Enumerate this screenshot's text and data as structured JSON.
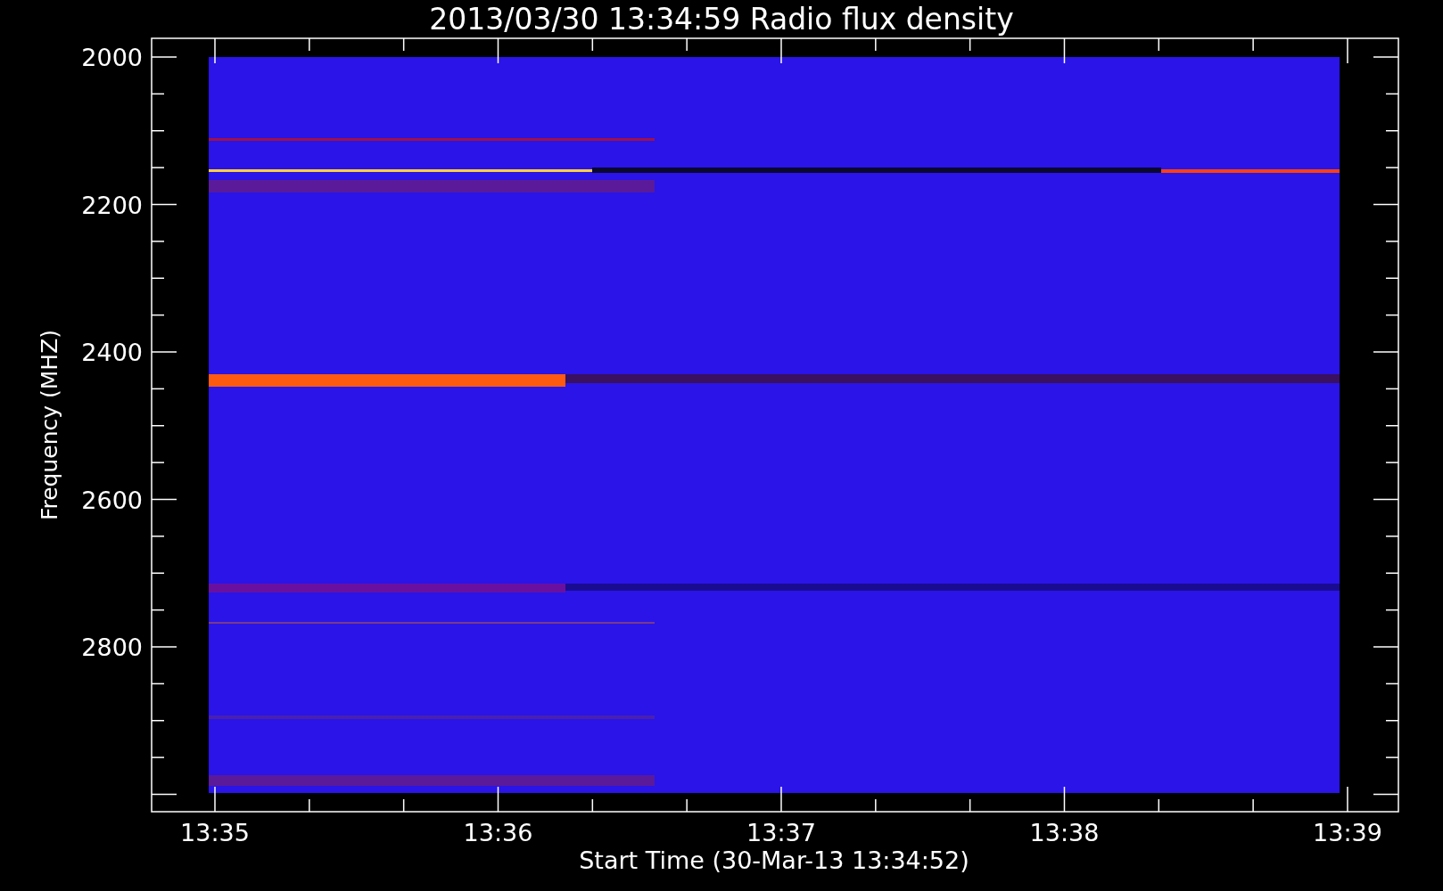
{
  "title": "2013/03/30 13:34:59 Radio flux density",
  "y_axis": {
    "label": "Frequency (MHZ)",
    "ticks": [
      "2000",
      "2200",
      "2400",
      "2600",
      "2800"
    ]
  },
  "x_axis": {
    "label": "Start Time (30-Mar-13 13:34:52)",
    "ticks": [
      "13:35",
      "13:36",
      "13:37",
      "13:38",
      "13:39"
    ]
  }
}
